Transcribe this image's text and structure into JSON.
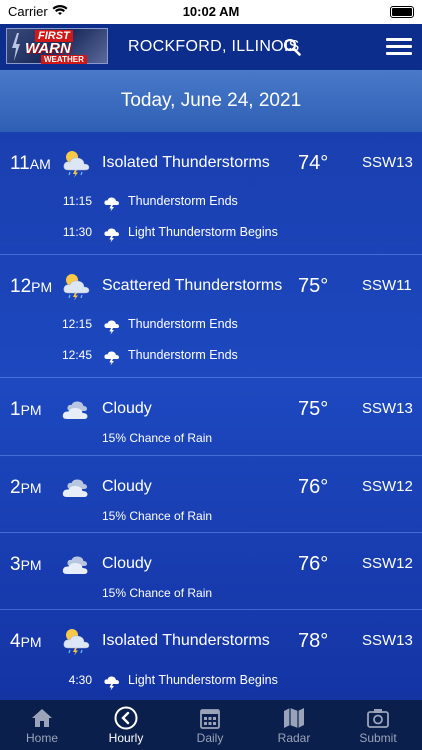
{
  "status_bar": {
    "carrier": "Carrier",
    "time": "10:02 AM"
  },
  "header": {
    "logo_text": [
      "FIRST",
      "WARN",
      "WEATHER"
    ],
    "location": "ROCKFORD, ILLINOIS"
  },
  "date_banner": "Today, June 24, 2021",
  "hours": [
    {
      "hour": "11",
      "ampm": "AM",
      "icon": "thunderstorm-icon",
      "condition": "Isolated Thunderstorms",
      "temp": "74°",
      "wind": "SSW13",
      "events": [
        {
          "time": "11:15",
          "icon": "thunderstorm-small-icon",
          "text": "Thunderstorm Ends"
        },
        {
          "time": "11:30",
          "icon": "thunderstorm-small-icon",
          "text": "Light Thunderstorm Begins"
        }
      ]
    },
    {
      "hour": "12",
      "ampm": "PM",
      "icon": "thunderstorm-icon",
      "condition": "Scattered Thunderstorms",
      "temp": "75°",
      "wind": "SSW11",
      "events": [
        {
          "time": "12:15",
          "icon": "thunderstorm-small-icon",
          "text": "Thunderstorm Ends"
        },
        {
          "time": "12:45",
          "icon": "thunderstorm-small-icon",
          "text": "Thunderstorm Ends"
        }
      ]
    },
    {
      "hour": "1",
      "ampm": "PM",
      "icon": "cloudy-icon",
      "condition": "Cloudy",
      "temp": "75°",
      "wind": "SSW13",
      "chance": "15% Chance of Rain"
    },
    {
      "hour": "2",
      "ampm": "PM",
      "icon": "cloudy-icon",
      "condition": "Cloudy",
      "temp": "76°",
      "wind": "SSW12",
      "chance": "15% Chance of Rain"
    },
    {
      "hour": "3",
      "ampm": "PM",
      "icon": "cloudy-icon",
      "condition": "Cloudy",
      "temp": "76°",
      "wind": "SSW12",
      "chance": "15% Chance of Rain"
    },
    {
      "hour": "4",
      "ampm": "PM",
      "icon": "thunderstorm-icon",
      "condition": "Isolated Thunderstorms",
      "temp": "78°",
      "wind": "SSW13",
      "events": [
        {
          "time": "4:30",
          "icon": "thunderstorm-small-icon",
          "text": "Light Thunderstorm Begins"
        }
      ]
    }
  ],
  "tabs": [
    {
      "label": "Home",
      "icon": "home-icon",
      "active": false
    },
    {
      "label": "Hourly",
      "icon": "hourly-icon",
      "active": true
    },
    {
      "label": "Daily",
      "icon": "calendar-icon",
      "active": false
    },
    {
      "label": "Radar",
      "icon": "map-icon",
      "active": false
    },
    {
      "label": "Submit",
      "icon": "camera-icon",
      "active": false
    }
  ],
  "colors": {
    "header": "#0c2d8c",
    "banner": "#3a6bc0",
    "content": "#1d48bf",
    "tabbar": "#0b1f4d"
  }
}
